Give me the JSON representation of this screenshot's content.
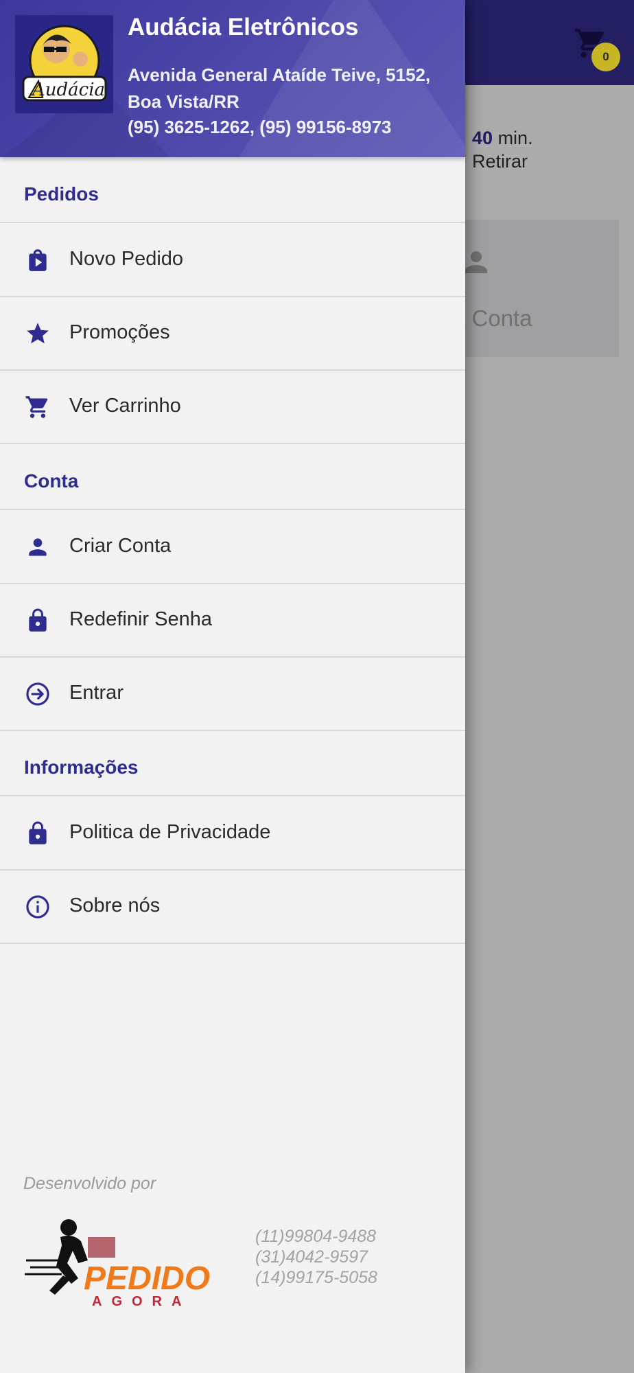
{
  "background": {
    "cart_count": "0",
    "delivery_time": "40",
    "delivery_unit": "min.",
    "pickup_label": "Retirar",
    "card_label": "a Conta"
  },
  "drawer": {
    "store_name": "Audácia Eletrônicos",
    "address": "Avenida General Ataíde Teive, 5152, Boa Vista/RR",
    "phones": "(95) 3625-1262, (95) 99156-8973",
    "logo_text": "Audácia",
    "sections": {
      "orders": "Pedidos",
      "account": "Conta",
      "info": "Informações"
    },
    "items": {
      "new_order": "Novo Pedido",
      "promotions": "Promoções",
      "view_cart": "Ver Carrinho",
      "create_account": "Criar Conta",
      "reset_password": "Redefinir Senha",
      "login": "Entrar",
      "privacy": "Politica de Privacidade",
      "about": "Sobre nós"
    },
    "footer": {
      "developed_by": "Desenvolvido por",
      "brand_line1": "PEDIDO",
      "brand_line2": "AGORA",
      "phone1": "(11)99804-9488",
      "phone2": "(31)4042-9597",
      "phone3": "(14)99175-5058"
    }
  },
  "colors": {
    "primary": "#2f2c8f",
    "header_dark": "#221e61",
    "badge": "#c7b524",
    "brand_orange": "#f07a1a"
  }
}
